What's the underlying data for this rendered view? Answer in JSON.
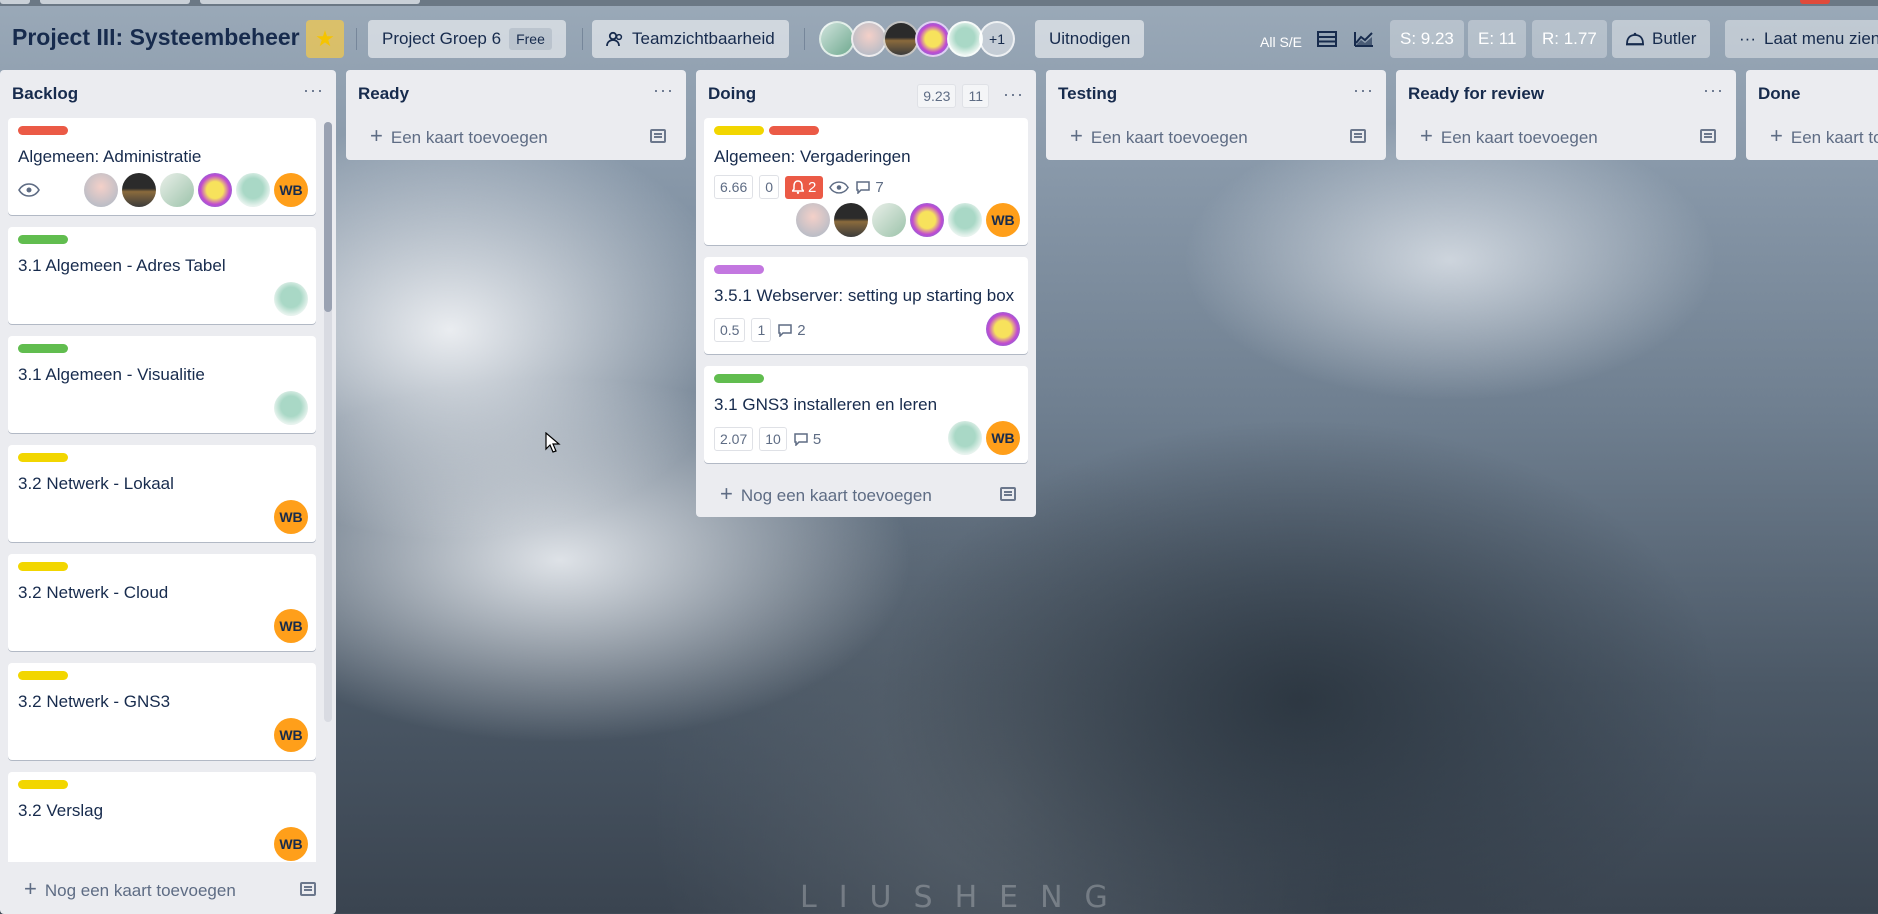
{
  "header": {
    "board_title": "Project III: Systeembeheer",
    "team_name": "Project Groep 6",
    "team_plan": "Free",
    "visibility": "Teamzichtbaarheid",
    "members_more": "+1",
    "invite": "Uitnodigen",
    "all_se": "All S/E",
    "stat_s": "S: 9.23",
    "stat_e": "E: 11",
    "stat_r": "R: 1.77",
    "butler": "Butler",
    "show_menu": "Laat menu zien"
  },
  "colors": {
    "label_red": "#eb5a46",
    "label_green": "#61bd4f",
    "label_yellow": "#f2d600",
    "label_purple": "#c377e0",
    "wb_orange": "#ff9f1a"
  },
  "lists": {
    "backlog": {
      "title": "Backlog",
      "add_more": "Nog een kaart toevoegen",
      "cards": [
        {
          "title": "Algemeen: Administratie"
        },
        {
          "title": "3.1 Algemeen - Adres Tabel"
        },
        {
          "title": "3.1 Algemeen - Visualitie"
        },
        {
          "title": "3.2 Netwerk - Lokaal"
        },
        {
          "title": "3.2 Netwerk - Cloud"
        },
        {
          "title": "3.2 Netwerk - GNS3"
        },
        {
          "title": "3.2 Verslag"
        }
      ]
    },
    "ready": {
      "title": "Ready",
      "add": "Een kaart toevoegen"
    },
    "doing": {
      "title": "Doing",
      "pt1": "9.23",
      "pt2": "11",
      "add_more": "Nog een kaart toevoegen",
      "cards": [
        {
          "title": "Algemeen: Vergaderingen",
          "pt1": "6.66",
          "pt2": "0",
          "notifications": "2",
          "comments": "7"
        },
        {
          "title": "3.5.1 Webserver: setting up starting box",
          "pt1": "0.5",
          "pt2": "1",
          "comments": "2"
        },
        {
          "title": "3.1 GNS3 installeren en leren",
          "pt1": "2.07",
          "pt2": "10",
          "comments": "5"
        }
      ]
    },
    "testing": {
      "title": "Testing",
      "add": "Een kaart toevoegen"
    },
    "review": {
      "title": "Ready for review",
      "add": "Een kaart toevoegen"
    },
    "done": {
      "title": "Done",
      "add": "Een kaart toevoegen"
    }
  },
  "avatar_initials": "WB",
  "watermark": "LIUSHENG"
}
